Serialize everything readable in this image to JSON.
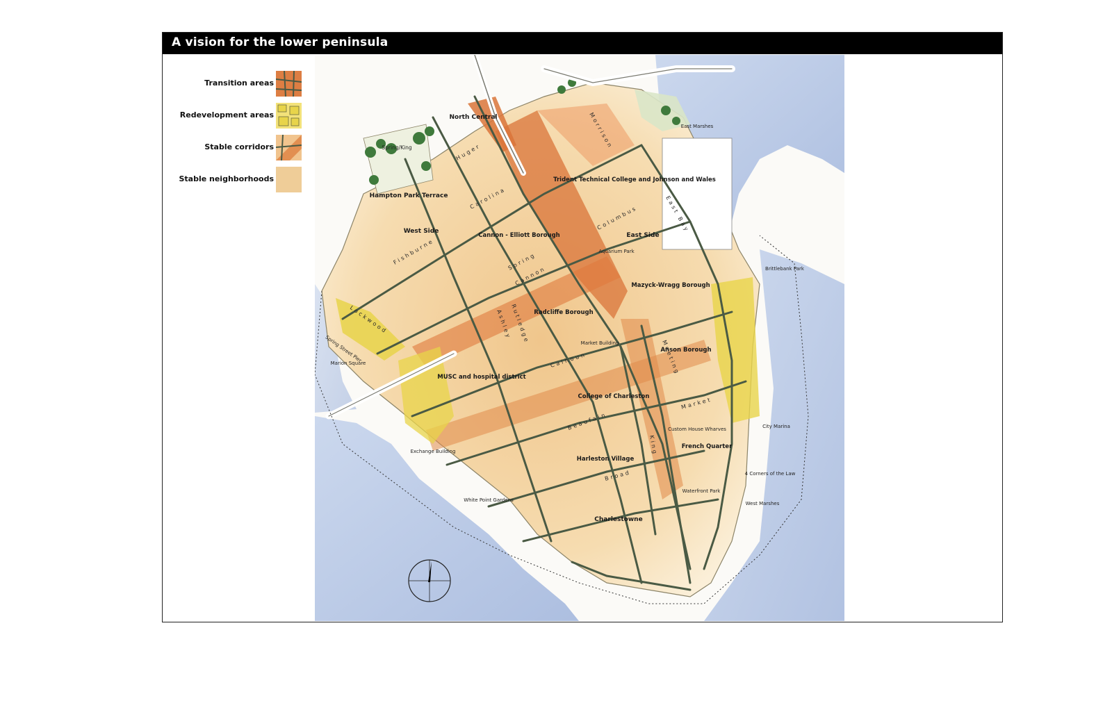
{
  "title": "A vision for the lower peninsula",
  "legend": [
    {
      "label": "Transition areas",
      "color": "#d9743a"
    },
    {
      "label": "Redevelopment areas",
      "color": "#e8d44a"
    },
    {
      "label": "Stable corridors",
      "color": "#e08a4a"
    },
    {
      "label": "Stable neighborhoods",
      "color": "#f1cf9a"
    }
  ],
  "colors": {
    "water": "#a9bde0",
    "land": "#f6e2bf",
    "street": "#4a5a44",
    "transition": "#d9743a",
    "redevelopment": "#e8d44a",
    "trees": "#3f7a3c"
  },
  "neighborhoods": [
    "North Central",
    "Hampton Park",
    "Hampton Park Terrace",
    "West Side",
    "Cannon - Elliott Borough",
    "Trident Technical College and Johnson and Wales",
    "East Side",
    "Mazyck-Wragg Borough",
    "Radcliffe Borough",
    "Anson Borough",
    "MUSC and hospital district",
    "College of Charleston",
    "Harleston Village",
    "French Quarter",
    "Charlestowne"
  ],
  "places": [
    "East Marshes",
    "Spring/King",
    "Aquarium Park",
    "Brittlebank Park",
    "Spring Street Pier",
    "Marion Square",
    "Market Building",
    "Custom House Wharves",
    "City Marina",
    "Exchange Building",
    "4 Corners of the Law",
    "Waterfront Park",
    "West Marshes",
    "White Point Gardens"
  ],
  "streets": [
    "Huger",
    "Morrison",
    "Carolina",
    "Columbus",
    "East Bay",
    "Fishburne",
    "Spring",
    "Cannon",
    "Rutledge",
    "Ashley",
    "Calhoun",
    "Meeting",
    "Market",
    "Beaufain",
    "King",
    "Broad",
    "Lockwood"
  ]
}
